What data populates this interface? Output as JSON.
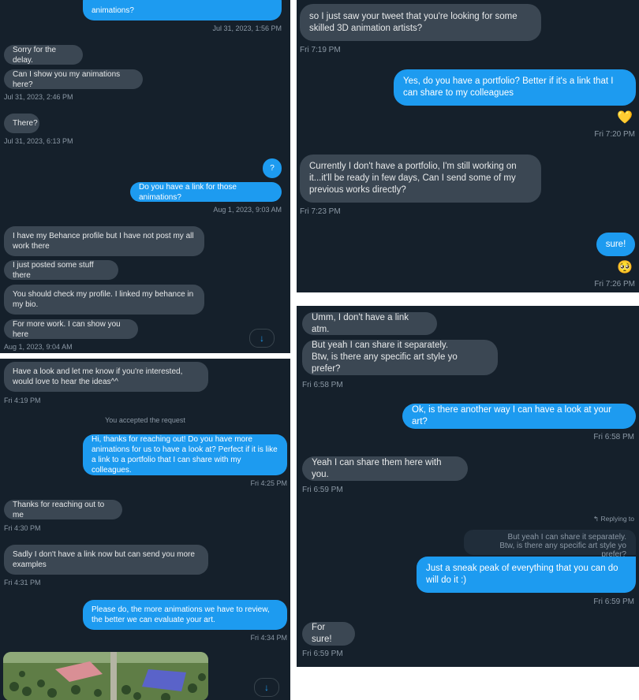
{
  "panel_a": {
    "top_bubble": "animations?",
    "top_ts": "Jul 31, 2023, 1:56 PM",
    "msgs": [
      "Sorry for the delay.",
      "Can I show you my animations here?",
      "Jul 31, 2023, 2:46 PM",
      "There?",
      "Jul 31, 2023, 6:13 PM",
      "?",
      "Do you have a link for those animations?",
      "Aug 1, 2023, 9:03 AM",
      "I have my Behance profile but I have not post my all work there",
      "I just posted some stuff there",
      "You should check my profile. I linked my behance in my bio.",
      "For more work. I can show you here",
      "Aug 1, 2023, 9:04 AM"
    ],
    "scroll_icon": "↓"
  },
  "panel_b": {
    "msgs": [
      "Have a look and let me know if you're interested, would love to hear the ideas^^",
      "Fri 4:19 PM",
      "You accepted the request",
      "Hi, thanks for reaching out! Do you have more animations for us to have a look at? Perfect if it is like a link to a portfolio that I can share with my colleagues.",
      "Fri 4:25 PM",
      "Thanks for reaching out to me",
      "Fri 4:30 PM",
      "Sadly I don't have a link now but can send you more examples",
      "Fri 4:31 PM",
      "Please do, the more animations we have to review, the better we can evaluate your art.",
      "Fri 4:34 PM"
    ],
    "scroll_icon": "↓"
  },
  "panel_c": {
    "msgs": [
      "so I just saw your tweet that you're looking for some skilled 3D animation artists?",
      "Fri 7:19 PM",
      "Yes, do you have a portfolio? Better if it's a link that I can share to my colleagues",
      "💛",
      "Fri 7:20 PM",
      "Currently I don't have a portfolio, I'm still working on it...it'll be ready in few days, Can I send some of my previous works directly?",
      "Fri 7:23 PM",
      "sure!",
      "🥺",
      "Fri 7:26 PM"
    ]
  },
  "panel_d": {
    "msgs": [
      "Umm, I don't have a link atm.",
      "But yeah I can share it separately.\nBtw, is there any specific art style yo prefer?",
      "Fri 6:58 PM",
      "Ok, is there another way I can have a look at your art?",
      "Fri 6:58 PM",
      "Yeah I can share them here with you.",
      "Fri 6:59 PM",
      "Replying to",
      "But yeah I can share it separately.\nBtw, is there any specific art style yo prefer?",
      "Just a sneak peak of everything that you can do will do it :)",
      "Fri 6:59 PM",
      "For sure!",
      "Fri 6:59 PM"
    ]
  },
  "colors": {
    "panel_bg": "#15202b",
    "incoming": "#3b4753",
    "outgoing": "#1d9bf0",
    "timestamp": "#8b98a5"
  }
}
